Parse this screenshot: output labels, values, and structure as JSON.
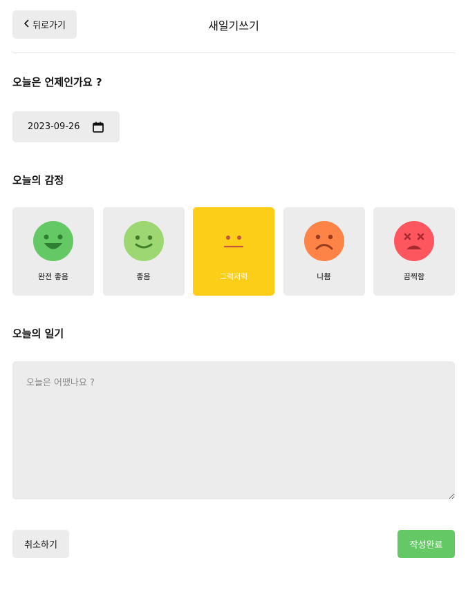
{
  "header": {
    "back_label": "뒤로가기",
    "title": "새일기쓰기"
  },
  "date_section": {
    "title": "오늘은 언제인가요 ?",
    "value": "2023-09-26"
  },
  "emotion_section": {
    "title": "오늘의 감정",
    "items": [
      {
        "label": "완전 좋음",
        "color": "#64c964",
        "icon": "very-happy-face-icon"
      },
      {
        "label": "좋음",
        "color": "#9dd772",
        "icon": "happy-face-icon"
      },
      {
        "label": "그럭저럭",
        "color": "#fdce17",
        "icon": "neutral-face-icon",
        "selected": true
      },
      {
        "label": "나쁨",
        "color": "#fd8446",
        "icon": "sad-face-icon"
      },
      {
        "label": "끔찍함",
        "color": "#fd565f",
        "icon": "terrible-face-icon"
      }
    ]
  },
  "diary_section": {
    "title": "오늘의 일기",
    "placeholder": "오늘은 어땠나요 ?",
    "value": ""
  },
  "footer": {
    "cancel_label": "취소하기",
    "submit_label": "작성완료"
  },
  "colors": {
    "accent": "#64c964",
    "selected": "#fdce17",
    "surface": "#ececec"
  }
}
